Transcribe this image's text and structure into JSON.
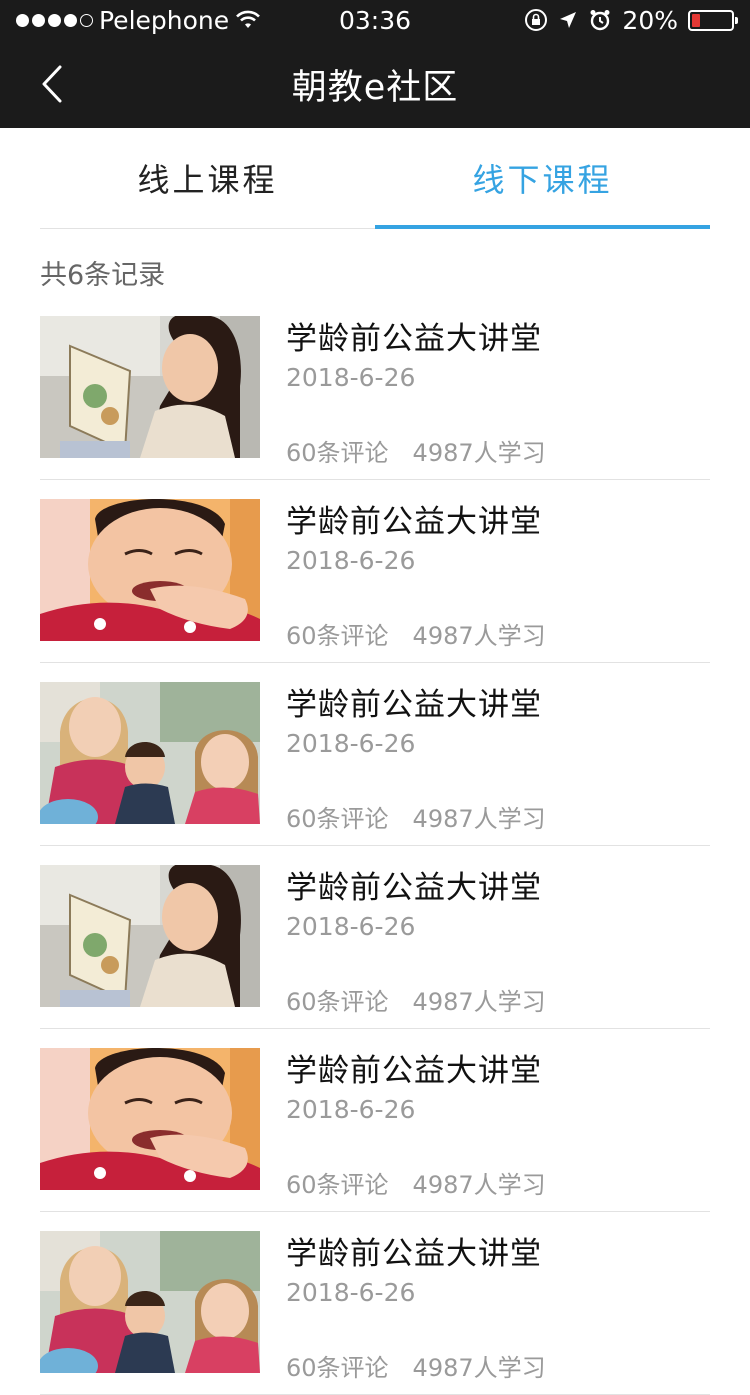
{
  "status_bar": {
    "carrier": "Pelephone",
    "time": "03:36",
    "battery_text": "20%",
    "battery_level": 0.2,
    "signal_bars_filled": 4,
    "signal_bars_total": 5,
    "icons": [
      "wifi-icon",
      "orientation-lock-icon",
      "location-icon",
      "alarm-icon",
      "battery-icon"
    ]
  },
  "nav": {
    "title": "朝教e社区",
    "back_icon": "chevron-left-icon"
  },
  "tabs": [
    {
      "label": "线上课程",
      "active": false
    },
    {
      "label": "线下课程",
      "active": true
    }
  ],
  "colors": {
    "accent": "#35a3e2",
    "bar_bg": "#1b1b1b",
    "battery_low": "#e53935"
  },
  "record_count": "共6条记录",
  "items": [
    {
      "title": "学龄前公益大讲堂",
      "date": "2018-6-26",
      "comments": "60条评论",
      "learners": "4987人学习",
      "thumb": "girl-reading"
    },
    {
      "title": "学龄前公益大讲堂",
      "date": "2018-6-26",
      "comments": "60条评论",
      "learners": "4987人学习",
      "thumb": "boy-smiling"
    },
    {
      "title": "学龄前公益大讲堂",
      "date": "2018-6-26",
      "comments": "60条评论",
      "learners": "4987人学习",
      "thumb": "children-group"
    },
    {
      "title": "学龄前公益大讲堂",
      "date": "2018-6-26",
      "comments": "60条评论",
      "learners": "4987人学习",
      "thumb": "girl-reading"
    },
    {
      "title": "学龄前公益大讲堂",
      "date": "2018-6-26",
      "comments": "60条评论",
      "learners": "4987人学习",
      "thumb": "boy-smiling"
    },
    {
      "title": "学龄前公益大讲堂",
      "date": "2018-6-26",
      "comments": "60条评论",
      "learners": "4987人学习",
      "thumb": "children-group"
    }
  ]
}
